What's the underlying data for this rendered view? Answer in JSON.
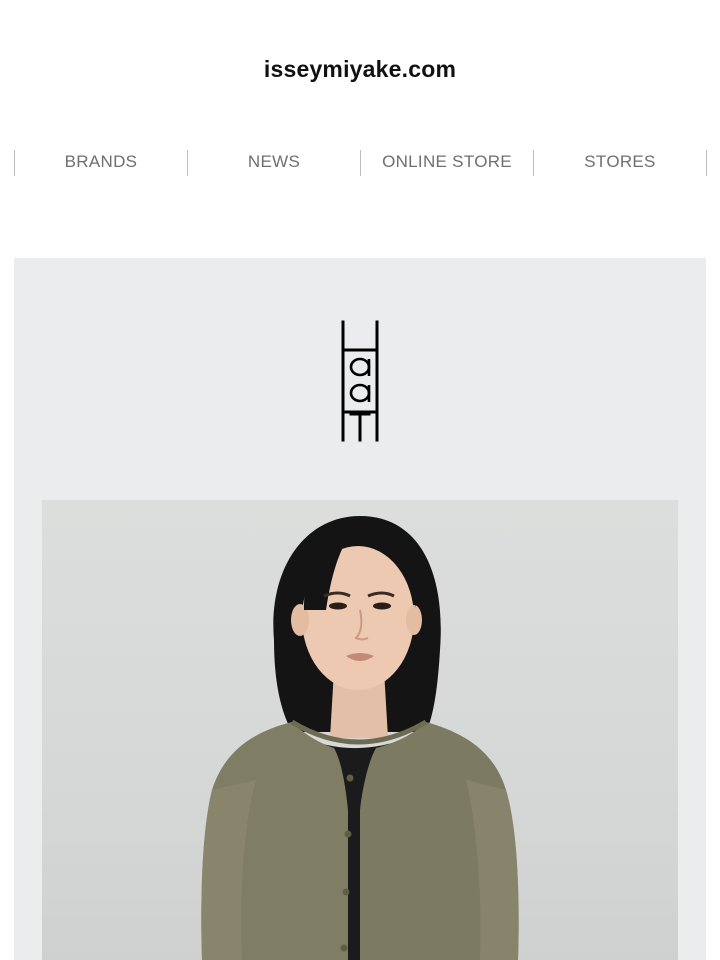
{
  "header": {
    "site_title": "isseymiyake.com"
  },
  "nav": {
    "items": [
      {
        "label": "BRANDS"
      },
      {
        "label": "NEWS"
      },
      {
        "label": "ONLINE STORE"
      },
      {
        "label": "STORES"
      }
    ]
  },
  "hero": {
    "brand_logo": "HaaT",
    "photo": "model-portrait"
  },
  "colors": {
    "hero_background": "#ebecee",
    "nav_text": "#6f6f6f",
    "title_text": "#111111",
    "cardigan": "#7f7d63"
  }
}
